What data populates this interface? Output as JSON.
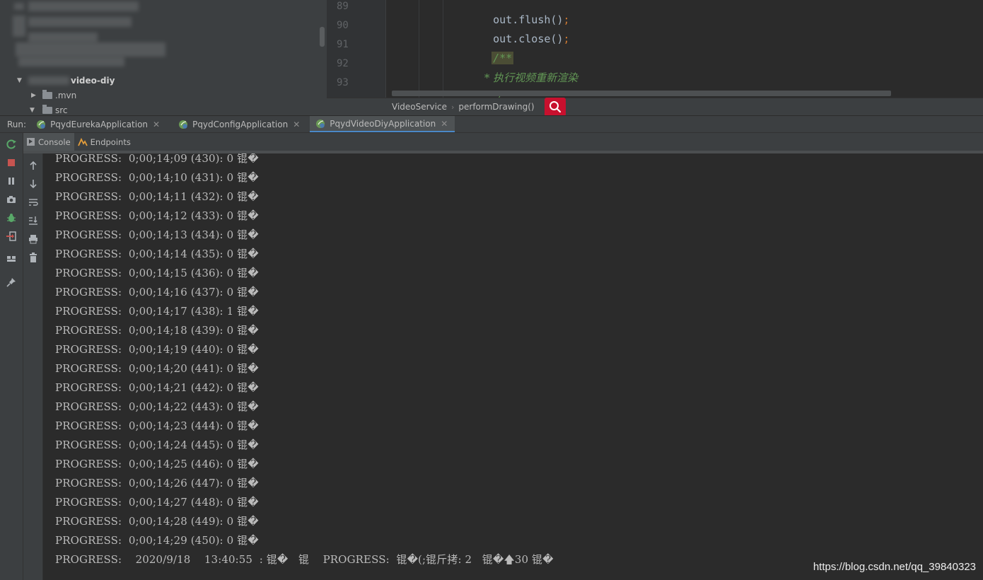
{
  "project_tree": {
    "module_name": "video-diy",
    "items": [
      {
        "label": ".mvn",
        "expanded": false
      },
      {
        "label": "src",
        "expanded": true
      }
    ]
  },
  "editor": {
    "lines": [
      {
        "num": "89",
        "text": "out.flush()",
        "semi": ";"
      },
      {
        "num": "90",
        "text": "out.close()",
        "semi": ";"
      },
      {
        "num": "91",
        "comment": "/**"
      },
      {
        "num": "92",
        "comment": " * 执行视频重新渲染"
      },
      {
        "num": "93",
        "comment": " * */"
      }
    ]
  },
  "breadcrumb": {
    "class_name": "VideoService",
    "method_name": "performDrawing()"
  },
  "run_panel": {
    "label": "Run:",
    "tabs": [
      {
        "label": "PqydEurekaApplication",
        "active": false
      },
      {
        "label": "PqydConfigApplication",
        "active": false
      },
      {
        "label": "PqydVideoDiyApplication",
        "active": true
      }
    ],
    "sub_tabs": [
      {
        "label": "Console",
        "active": true
      },
      {
        "label": "Endpoints",
        "active": false
      }
    ]
  },
  "console": {
    "lines": [
      "PROGRESS:  0;00;14;09 (430): 0 锟�",
      "PROGRESS:  0;00;14;10 (431): 0 锟�",
      "PROGRESS:  0;00;14;11 (432): 0 锟�",
      "PROGRESS:  0;00;14;12 (433): 0 锟�",
      "PROGRESS:  0;00;14;13 (434): 0 锟�",
      "PROGRESS:  0;00;14;14 (435): 0 锟�",
      "PROGRESS:  0;00;14;15 (436): 0 锟�",
      "PROGRESS:  0;00;14;16 (437): 0 锟�",
      "PROGRESS:  0;00;14;17 (438): 1 锟�",
      "PROGRESS:  0;00;14;18 (439): 0 锟�",
      "PROGRESS:  0;00;14;19 (440): 0 锟�",
      "PROGRESS:  0;00;14;20 (441): 0 锟�",
      "PROGRESS:  0;00;14;21 (442): 0 锟�",
      "PROGRESS:  0;00;14;22 (443): 0 锟�",
      "PROGRESS:  0;00;14;23 (444): 0 锟�",
      "PROGRESS:  0;00;14;24 (445): 0 锟�",
      "PROGRESS:  0;00;14;25 (446): 0 锟�",
      "PROGRESS:  0;00;14;26 (447): 0 锟�",
      "PROGRESS:  0;00;14;27 (448): 0 锟�",
      "PROGRESS:  0;00;14;28 (449): 0 锟�",
      "PROGRESS:  0;00;14;29 (450): 0 锟�",
      "PROGRESS:    2020/9/18    13:40:55  : 锟�   锟    PROGRESS:  锟�(;锟斤拷: 2   锟�🡅30 锟�"
    ]
  },
  "watermark": "https://blog.csdn.net/qq_39840323",
  "colors": {
    "accent_blue": "#4a88c7",
    "search_red": "#c8102e",
    "comment_green": "#629755",
    "rerun_green": "#59a869",
    "stop_red": "#c75450"
  }
}
